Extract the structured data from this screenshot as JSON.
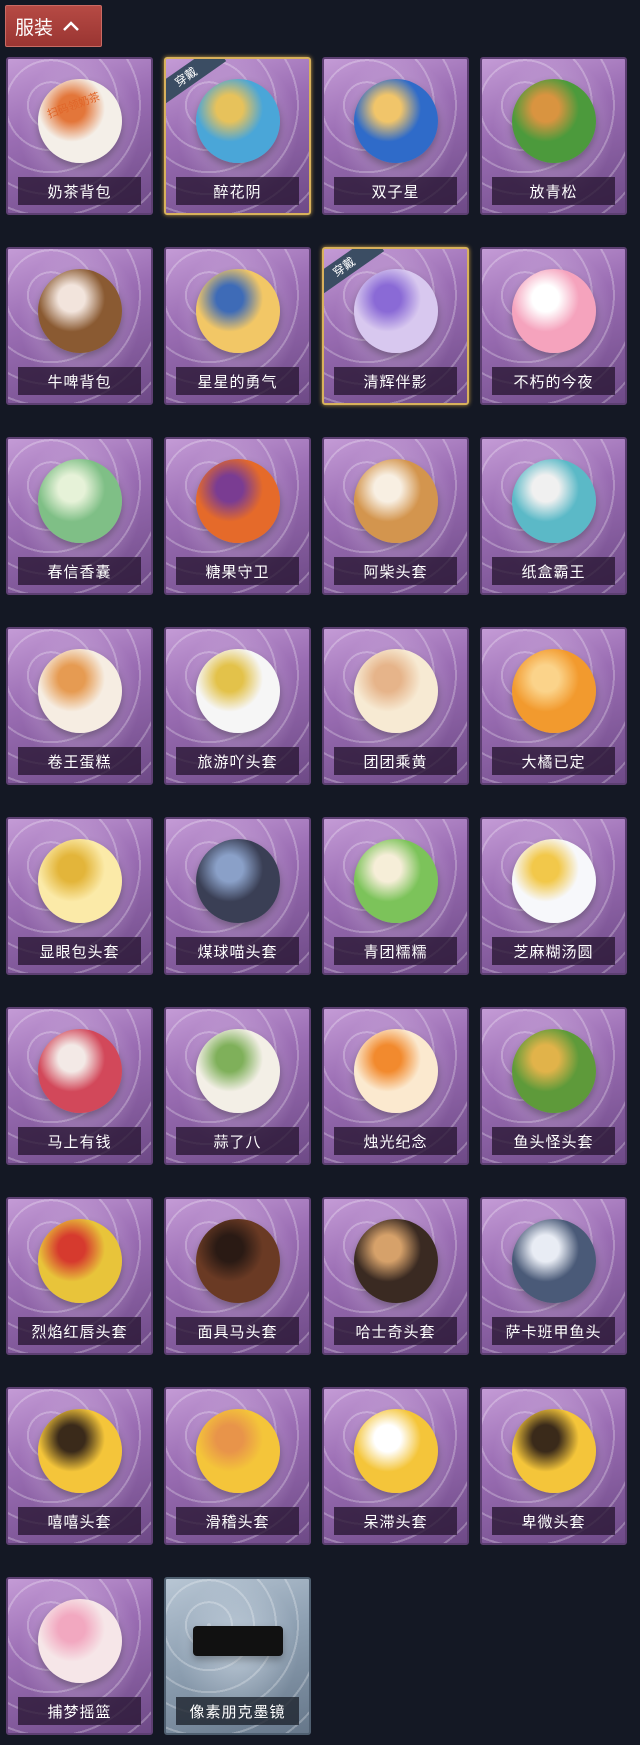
{
  "header": {
    "title": "服装",
    "toggle_icon": "chevron-up-icon"
  },
  "items": [
    {
      "label": "奶茶背包",
      "art_color": "#f4efe8",
      "accent": "#e3763a",
      "badge": "扫码领奶茶",
      "equipped": false,
      "grey": false
    },
    {
      "label": "醉花阴",
      "art_color": "#4aa6d8",
      "accent": "#e7c25b",
      "equipped": true,
      "grey": false
    },
    {
      "label": "双子星",
      "art_color": "#2f6bc9",
      "accent": "#f1c56a",
      "equipped": false,
      "grey": false
    },
    {
      "label": "放青松",
      "art_color": "#4c9a3c",
      "accent": "#d99440",
      "equipped": false,
      "grey": false
    },
    {
      "label": "牛啤背包",
      "art_color": "#8a5a32",
      "accent": "#f2e4dc",
      "equipped": false,
      "grey": false
    },
    {
      "label": "星星的勇气",
      "art_color": "#f2c766",
      "accent": "#3e6bb7",
      "equipped": false,
      "grey": false
    },
    {
      "label": "清辉伴影",
      "art_color": "#d8c8ef",
      "accent": "#8a6ad6",
      "equipped": true,
      "grey": false
    },
    {
      "label": "不朽的今夜",
      "art_color": "#f5a3bd",
      "accent": "#ffffff",
      "equipped": false,
      "grey": false
    },
    {
      "label": "春信香囊",
      "art_color": "#7fbf86",
      "accent": "#e6f2d8",
      "equipped": false,
      "grey": false
    },
    {
      "label": "糖果守卫",
      "art_color": "#e56a2a",
      "accent": "#7a3c92",
      "equipped": false,
      "grey": false
    },
    {
      "label": "阿柴头套",
      "art_color": "#d3954e",
      "accent": "#f8efe2",
      "equipped": false,
      "grey": false
    },
    {
      "label": "纸盒霸王",
      "art_color": "#5bb9c7",
      "accent": "#f0f0f0",
      "equipped": false,
      "grey": false
    },
    {
      "label": "卷王蛋糕",
      "art_color": "#f6ede2",
      "accent": "#e69b52",
      "equipped": false,
      "grey": false
    },
    {
      "label": "旅游吖头套",
      "art_color": "#f6f6f6",
      "accent": "#e3c24a",
      "equipped": false,
      "grey": false
    },
    {
      "label": "团团乘黄",
      "art_color": "#f7ead3",
      "accent": "#e6b48a",
      "equipped": false,
      "grey": false
    },
    {
      "label": "大橘已定",
      "art_color": "#f29a2e",
      "accent": "#fbd38a",
      "equipped": false,
      "grey": false
    },
    {
      "label": "显眼包头套",
      "art_color": "#fbeaa8",
      "accent": "#e3b53a",
      "equipped": false,
      "grey": false
    },
    {
      "label": "煤球喵头套",
      "art_color": "#3a3f55",
      "accent": "#8aa0c8",
      "equipped": false,
      "grey": false
    },
    {
      "label": "青团糯糯",
      "art_color": "#7cc35a",
      "accent": "#f6eed8",
      "equipped": false,
      "grey": false
    },
    {
      "label": "芝麻糊汤圆",
      "art_color": "#f7f8fb",
      "accent": "#f2c84a",
      "equipped": false,
      "grey": false
    },
    {
      "label": "马上有钱",
      "art_color": "#d2485a",
      "accent": "#f3e9e6",
      "equipped": false,
      "grey": false
    },
    {
      "label": "蒜了八",
      "art_color": "#f3efe6",
      "accent": "#7fb05a",
      "equipped": false,
      "grey": false
    },
    {
      "label": "烛光纪念",
      "art_color": "#fbe9cf",
      "accent": "#f28a2e",
      "equipped": false,
      "grey": false
    },
    {
      "label": "鱼头怪头套",
      "art_color": "#5e9a3a",
      "accent": "#e1b34a",
      "equipped": false,
      "grey": false
    },
    {
      "label": "烈焰红唇头套",
      "art_color": "#e8c43a",
      "accent": "#d63a2e",
      "equipped": false,
      "grey": false
    },
    {
      "label": "面具马头套",
      "art_color": "#6a3a24",
      "accent": "#2a1a14",
      "equipped": false,
      "grey": false
    },
    {
      "label": "哈士奇头套",
      "art_color": "#3a2a22",
      "accent": "#d6a16a",
      "equipped": false,
      "grey": false
    },
    {
      "label": "萨卡班甲鱼头",
      "art_color": "#4a5a78",
      "accent": "#e8ecf4",
      "equipped": false,
      "grey": false
    },
    {
      "label": "嘻嘻头套",
      "art_color": "#f4c53a",
      "accent": "#3a2a1a",
      "equipped": false,
      "grey": false
    },
    {
      "label": "滑稽头套",
      "art_color": "#f4c53a",
      "accent": "#e8944a",
      "equipped": false,
      "grey": false
    },
    {
      "label": "呆滞头套",
      "art_color": "#f4c53a",
      "accent": "#ffffff",
      "equipped": false,
      "grey": false
    },
    {
      "label": "卑微头套",
      "art_color": "#f4c53a",
      "accent": "#3a2a1a",
      "equipped": false,
      "grey": false
    },
    {
      "label": "捕梦摇篮",
      "art_color": "#f6e6e8",
      "accent": "#f2a8c0",
      "equipped": false,
      "grey": false
    },
    {
      "label": "像素朋克墨镜",
      "art_color": "#1a1a1a",
      "accent": "#ffffff",
      "equipped": false,
      "grey": true
    }
  ],
  "equipped_badge": "穿戴"
}
